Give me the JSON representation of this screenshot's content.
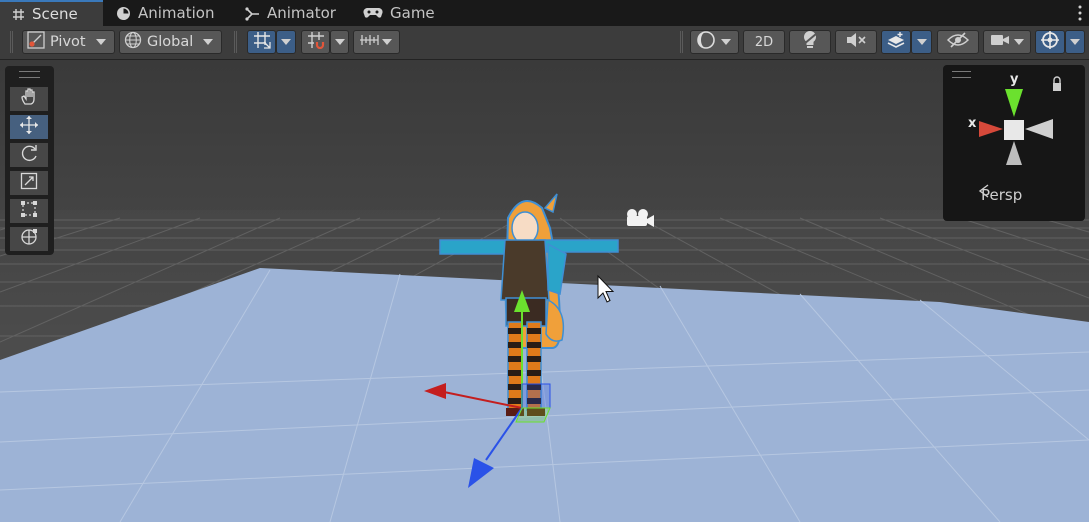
{
  "tabs": [
    {
      "label": "Scene",
      "icon": "hash-icon",
      "active": true
    },
    {
      "label": "Animation",
      "icon": "clock-icon",
      "active": false
    },
    {
      "label": "Animator",
      "icon": "animator-icon",
      "active": false
    },
    {
      "label": "Game",
      "icon": "gamepad-icon",
      "active": false
    }
  ],
  "toolbar": {
    "pivot_label": "Pivot",
    "global_label": "Global",
    "mode_2d_label": "2D"
  },
  "tools": [
    "hand-tool",
    "move-tool",
    "rotate-tool",
    "scale-tool",
    "rect-tool",
    "transform-tool"
  ],
  "gizmo": {
    "y_label": "y",
    "x_label": "x",
    "projection_label": "Persp"
  },
  "colors": {
    "accent_blue": "#3c5e87",
    "ground_plane": "#9db3d6",
    "axis_x": "#c41e1e",
    "axis_y": "#6be12e",
    "axis_z": "#2a52e8"
  }
}
